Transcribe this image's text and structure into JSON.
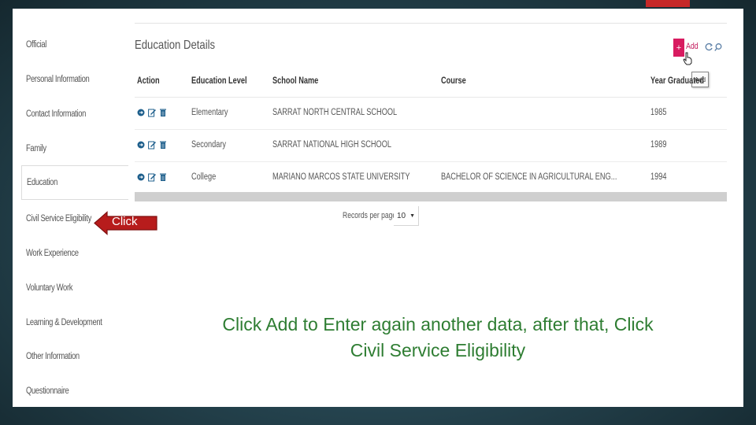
{
  "sidebar": {
    "items": [
      {
        "label": "Official"
      },
      {
        "label": "Personal Information"
      },
      {
        "label": "Contact Information"
      },
      {
        "label": "Family"
      },
      {
        "label": "Education",
        "active": true
      },
      {
        "label": "Civil Service Eligibility"
      },
      {
        "label": "Work Experience"
      },
      {
        "label": "Voluntary Work"
      },
      {
        "label": "Learning & Development"
      },
      {
        "label": "Other Information"
      },
      {
        "label": "Questionnaire"
      }
    ]
  },
  "panel": {
    "title": "Education Details",
    "add_icon": "+",
    "add_label": "Add",
    "tooltip": "Add"
  },
  "table": {
    "headers": [
      "Action",
      "Education Level",
      "School Name",
      "Course",
      "Year Graduated"
    ],
    "rows": [
      {
        "level": "Elementary",
        "school": "SARRAT NORTH CENTRAL SCHOOL",
        "course": "",
        "year": "1985"
      },
      {
        "level": "Secondary",
        "school": "SARRAT NATIONAL HIGH SCHOOL",
        "course": "",
        "year": "1989"
      },
      {
        "level": "College",
        "school": "MARIANO MARCOS STATE UNIVERSITY",
        "course": "BACHELOR OF SCIENCE IN AGRICULTURAL ENG...",
        "year": "1994"
      }
    ]
  },
  "pagination": {
    "records_label": "Records per page",
    "records_value": "10",
    "dropdown_glyph": "▼"
  },
  "callout": {
    "label": "Click"
  },
  "instruction": {
    "line1": "Click Add to Enter again another data, after that, Click",
    "line2": "Civil Service Eligibility"
  },
  "colors": {
    "accent": "#d81b60",
    "callout_fill": "#b71c1c",
    "instruction_text": "#2e7d32",
    "top_accent": "#c62828"
  }
}
